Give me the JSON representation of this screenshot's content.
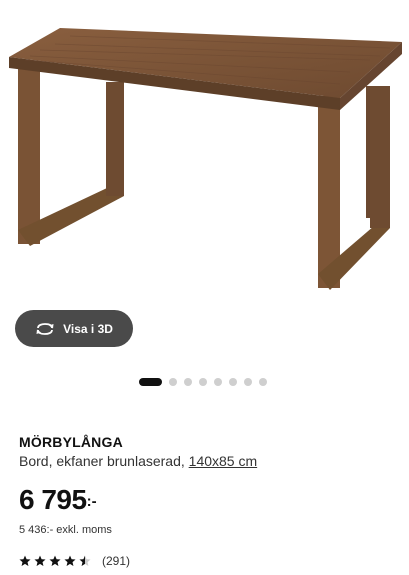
{
  "product": {
    "name": "MÖRBYLÅNGA",
    "description": "Bord, ekfaner brunlaserad,",
    "size": "140x85 cm",
    "price_main": "6 795",
    "price_suffix": ":-",
    "price_ex_vat": "5 436:- exkl. moms",
    "rating_value": 4.5,
    "rating_max": 5,
    "rating_count": "(291)"
  },
  "view3d": {
    "label": "Visa i 3D",
    "icon": "rotate-3d-icon"
  },
  "gallery": {
    "image_count": 8,
    "active_index": 0
  },
  "colors": {
    "button_bg": "#4a4a4a",
    "active_dot": "#111111",
    "inactive_dot": "#cfcfcf",
    "wood": "#7a5234"
  }
}
